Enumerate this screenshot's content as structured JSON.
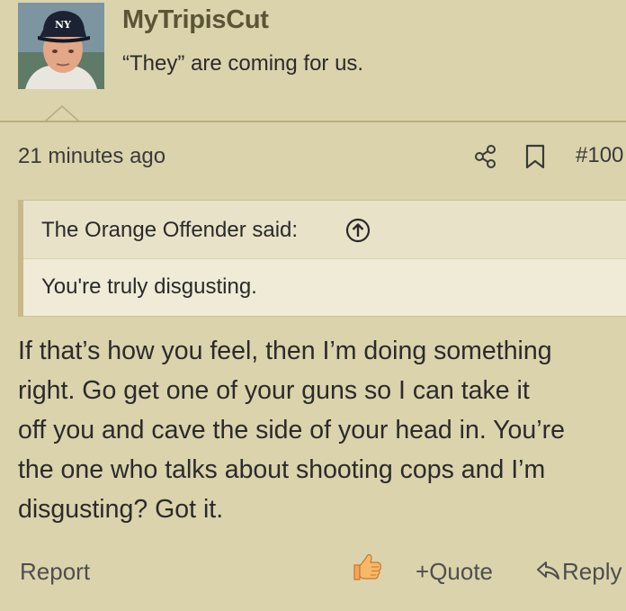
{
  "post": {
    "username": "MyTripisCut",
    "user_title": "“They” are coming for us.",
    "timestamp": "21 minutes ago",
    "post_number": "#100",
    "icons": {
      "avatar": "baseball-player-avatar",
      "share": "share-icon",
      "bookmark": "bookmark-icon"
    }
  },
  "quote": {
    "attribution": "The Orange Offender said:",
    "jump_icon": "arrow-up-circle-icon",
    "text": "You're truly disgusting."
  },
  "message": {
    "lines": [
      "If that’s how you feel, then I’m doing something",
      "right. Go get one of your guns so I can take it",
      "off you and cave the side of your head in. You’re",
      "the one who talks about shooting cops and I’m",
      "disgusting? Got it."
    ]
  },
  "actions": {
    "report": "Report",
    "like_icon": "thumbs-up-icon",
    "quote_plus": "+",
    "quote": "Quote",
    "reply": "Reply"
  },
  "colors": {
    "background": "#dbd3ac",
    "username": "#5b5436",
    "quote_background": "#efebd6",
    "quote_border": "#c7b98a"
  }
}
